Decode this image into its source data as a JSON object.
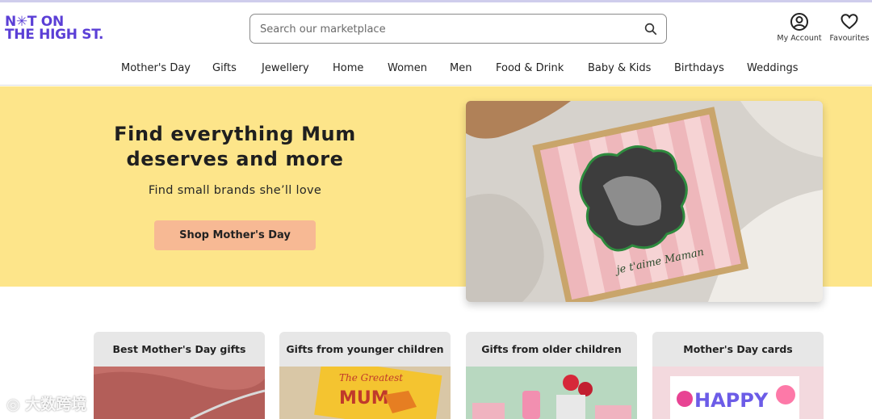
{
  "logo": {
    "line1": "N✳T ON",
    "line2": "THE HIGH ST."
  },
  "search": {
    "placeholder": "Search our marketplace"
  },
  "header": {
    "account_label": "My Account",
    "favourites_label": "Favourites"
  },
  "nav": {
    "items": [
      {
        "label": "Mother's Day"
      },
      {
        "label": "Gifts"
      },
      {
        "label": "Jewellery"
      },
      {
        "label": "Home"
      },
      {
        "label": "Women"
      },
      {
        "label": "Men"
      },
      {
        "label": "Food & Drink"
      },
      {
        "label": "Baby & Kids"
      },
      {
        "label": "Birthdays"
      },
      {
        "label": "Weddings"
      }
    ]
  },
  "hero": {
    "title": "Find everything Mum deserves and more",
    "subtitle": "Find small brands she’ll love",
    "cta": "Shop Mother's Day",
    "image_caption": "je t'aime Maman"
  },
  "categories": [
    {
      "label": "Best Mother's Day gifts"
    },
    {
      "label": "Gifts from younger children"
    },
    {
      "label": "Gifts from older children"
    },
    {
      "label": "Mother's Day cards"
    }
  ],
  "card_texts": {
    "greatest": "The Greatest",
    "mum": "MUM",
    "happy": "HAPPY"
  },
  "watermark": "大数跨境",
  "colors": {
    "brand": "#5b3fd6",
    "hero_bg": "#fde58a",
    "cta_bg": "#f7b994"
  }
}
